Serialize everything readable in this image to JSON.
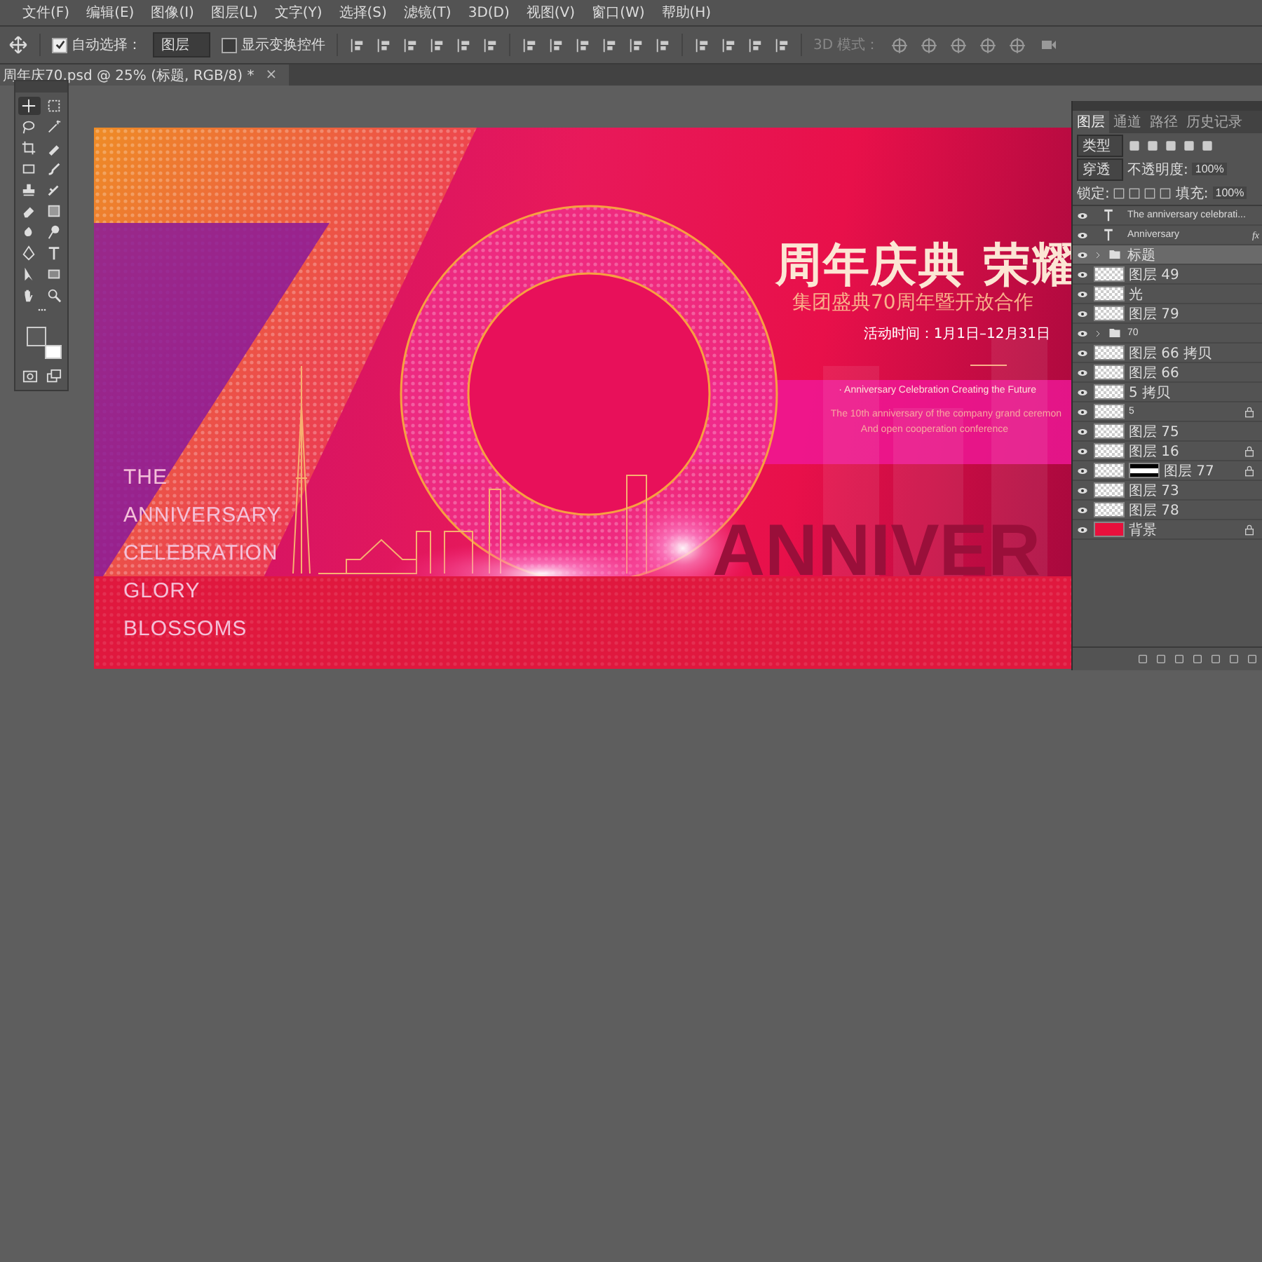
{
  "menu": [
    "文件(F)",
    "编辑(E)",
    "图像(I)",
    "图层(L)",
    "文字(Y)",
    "选择(S)",
    "滤镜(T)",
    "3D(D)",
    "视图(V)",
    "窗口(W)",
    "帮助(H)"
  ],
  "options_bar": {
    "auto_select": {
      "label": "自动选择：",
      "checked": true
    },
    "target": "图层",
    "show_transform": {
      "label": "显示变换控件",
      "checked": false
    },
    "mode_3d": "3D 模式："
  },
  "document_tab": {
    "title": "周年庆70.psd @ 25% (标题, RGB/8) *",
    "close": "×"
  },
  "tools": [
    {
      "kind": "move",
      "selected": true
    },
    {
      "kind": "marquee",
      "selected": false
    },
    {
      "kind": "lasso",
      "selected": false
    },
    {
      "kind": "wand",
      "selected": false
    },
    {
      "kind": "crop",
      "selected": false
    },
    {
      "kind": "eyedropper",
      "selected": false
    },
    {
      "kind": "frame",
      "selected": false
    },
    {
      "kind": "brush",
      "selected": false
    },
    {
      "kind": "stamp",
      "selected": false
    },
    {
      "kind": "history",
      "selected": false
    },
    {
      "kind": "eraser",
      "selected": false
    },
    {
      "kind": "gradient",
      "selected": false
    },
    {
      "kind": "blur",
      "selected": false
    },
    {
      "kind": "dodge",
      "selected": false
    },
    {
      "kind": "pen",
      "selected": false
    },
    {
      "kind": "type",
      "selected": false
    },
    {
      "kind": "select",
      "selected": false
    },
    {
      "kind": "rectangle",
      "selected": false
    },
    {
      "kind": "hand",
      "selected": false
    },
    {
      "kind": "zoom",
      "selected": false
    }
  ],
  "artwork": {
    "title": "周年庆典 荣耀",
    "subtitle": "集团盛典70周年暨开放合作",
    "date": "活动时间：1月1日–12月31日",
    "tagline": "· Anniversary Celebration Creating the Future",
    "description": [
      "The 10th anniversary of the company grand ceremon",
      "And open cooperation conference"
    ],
    "left_lines": [
      "THE",
      "ANNIVERSARY",
      "CELEBRATION",
      "GLORY",
      "BLOSSOMS"
    ],
    "big_word": "ANNIVER"
  },
  "layers_panel": {
    "tabs": [
      {
        "label": "图层",
        "selected": true
      },
      {
        "label": "通道",
        "selected": false
      },
      {
        "label": "路径",
        "selected": false
      },
      {
        "label": "历史记录",
        "selected": false
      }
    ],
    "filter": "类型",
    "blend_mode": "穿透",
    "opacity_label": "不透明度:",
    "opacity": "100%",
    "lock_label": "锁定:",
    "fill_label": "填充:",
    "fill": "100%",
    "layers": [
      {
        "kind": "text",
        "name": "The anniversary celebrati...",
        "selected": false,
        "locked": false
      },
      {
        "kind": "text",
        "name": "Anniversary",
        "badge": "fx",
        "selected": false,
        "locked": false
      },
      {
        "kind": "group",
        "name": "标题",
        "expanded": false,
        "selected": true,
        "locked": false
      },
      {
        "kind": "pixel",
        "name": "图层 49",
        "selected": false,
        "locked": false
      },
      {
        "kind": "pixel",
        "name": "光",
        "selected": false,
        "locked": false
      },
      {
        "kind": "pixel",
        "name": "图层 79",
        "selected": false,
        "locked": false
      },
      {
        "kind": "group",
        "name": "70",
        "expanded": false,
        "selected": false,
        "locked": false
      },
      {
        "kind": "pixel",
        "name": "图层 66 拷贝",
        "selected": false,
        "locked": false
      },
      {
        "kind": "pixel",
        "name": "图层 66",
        "selected": false,
        "locked": false
      },
      {
        "kind": "pixel",
        "name": "5 拷贝",
        "selected": false,
        "locked": false
      },
      {
        "kind": "pixel",
        "name": "5",
        "selected": false,
        "locked": true
      },
      {
        "kind": "pixel",
        "name": "图层 75",
        "selected": false,
        "locked": false
      },
      {
        "kind": "pixel",
        "name": "图层 16",
        "selected": false,
        "locked": true
      },
      {
        "kind": "masked",
        "name": "图层 77",
        "selected": false,
        "locked": true
      },
      {
        "kind": "pixel",
        "name": "图层 73",
        "selected": false,
        "locked": false
      },
      {
        "kind": "pixel",
        "name": "图层 78",
        "selected": false,
        "locked": false
      },
      {
        "kind": "background",
        "name": "背景",
        "selected": false,
        "locked": true
      }
    ]
  }
}
